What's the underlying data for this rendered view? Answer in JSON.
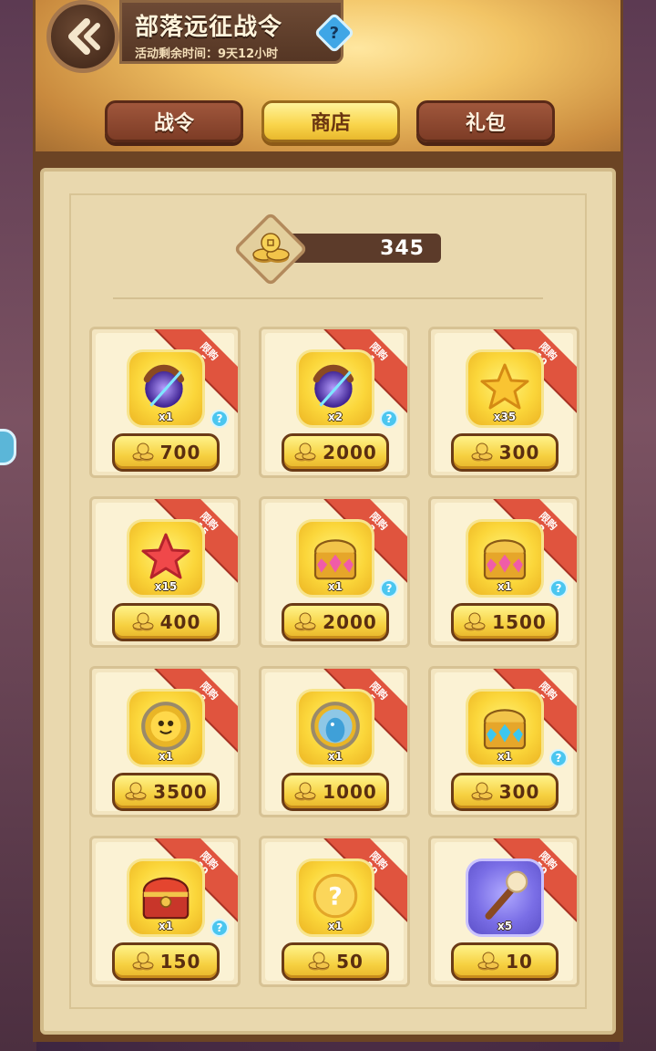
{
  "header": {
    "title": "部落远征战令",
    "timer": "活动剩余时间：9天12小时",
    "help_label": "?"
  },
  "tabs": [
    {
      "label": "战令",
      "active": false
    },
    {
      "label": "商店",
      "active": true
    },
    {
      "label": "礼包",
      "active": false
    }
  ],
  "currency": {
    "amount": "345",
    "icon": "coin-stack-icon"
  },
  "shop": {
    "limit_label": "限购",
    "info_label": "?",
    "items": [
      {
        "icon": "chaos-orb-icon",
        "qty": "x1",
        "price": "700",
        "limit": "5",
        "info": true,
        "frame": "gold"
      },
      {
        "icon": "chaos-orb-icon",
        "qty": "x2",
        "price": "2000",
        "limit": "1",
        "info": true,
        "frame": "gold"
      },
      {
        "icon": "gold-star-icon",
        "qty": "x35",
        "price": "300",
        "limit": "10",
        "info": false,
        "frame": "gold"
      },
      {
        "icon": "red-star-icon",
        "qty": "x15",
        "price": "400",
        "limit": "15",
        "info": false,
        "frame": "gold"
      },
      {
        "icon": "pink-crystal-chest-icon",
        "qty": "x1",
        "price": "2000",
        "limit": "3",
        "info": true,
        "frame": "gold"
      },
      {
        "icon": "pink-crystal-chest-icon",
        "qty": "x1",
        "price": "1500",
        "limit": "2",
        "info": true,
        "frame": "gold"
      },
      {
        "icon": "yellow-creature-token-icon",
        "qty": "x1",
        "price": "3500",
        "limit": "8",
        "info": false,
        "frame": "gold"
      },
      {
        "icon": "blue-creature-token-icon",
        "qty": "x1",
        "price": "1000",
        "limit": "5",
        "info": false,
        "frame": "gold"
      },
      {
        "icon": "blue-crystal-chest-icon",
        "qty": "x1",
        "price": "300",
        "limit": "5",
        "info": true,
        "frame": "gold"
      },
      {
        "icon": "red-treasure-chest-icon",
        "qty": "x1",
        "price": "150",
        "limit": "20",
        "info": true,
        "frame": "gold"
      },
      {
        "icon": "mystery-orb-icon",
        "qty": "x1",
        "price": "50",
        "limit": "20",
        "info": false,
        "frame": "gold"
      },
      {
        "icon": "wooden-staff-icon",
        "qty": "x5",
        "price": "10",
        "limit": "50",
        "info": false,
        "frame": "blue"
      }
    ]
  }
}
